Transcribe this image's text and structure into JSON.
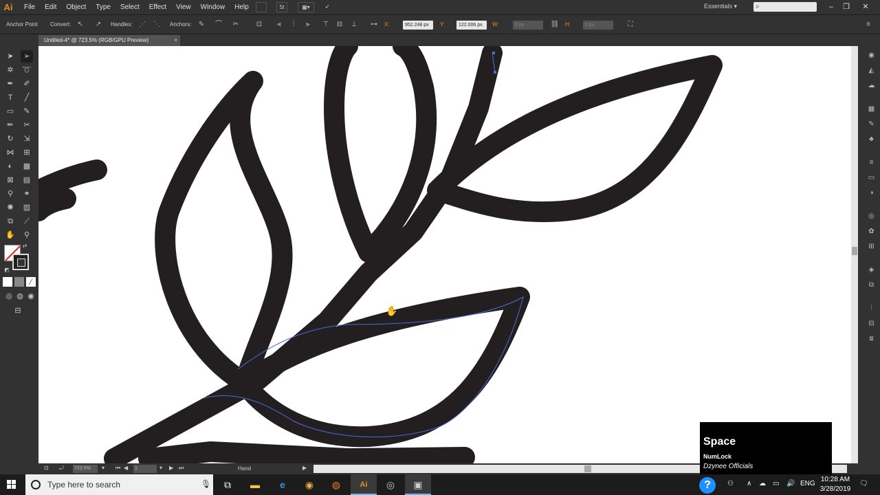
{
  "app": {
    "logo": "Ai",
    "menu": [
      "File",
      "Edit",
      "Object",
      "Type",
      "Select",
      "Effect",
      "View",
      "Window",
      "Help"
    ],
    "menu_icons": [
      "bridge-icon",
      "stock-icon",
      "arrange-documents-icon",
      "gpu-performance-icon"
    ],
    "stock_label": "St",
    "workspace": "Essentials",
    "search_placeholder": "",
    "window_controls": [
      "minimize-icon",
      "restore-icon",
      "close-icon"
    ]
  },
  "control_bar": {
    "anchor_point": "Anchor Point",
    "convert": "Convert:",
    "handles": "Handles:",
    "anchors": "Anchors:",
    "x_label": "X:",
    "x_value": "952.248 px",
    "y_label": "Y:",
    "y_value": "122.006 px",
    "w_label": "W:",
    "w_value": "0 px",
    "h_label": "H:",
    "h_value": "0 px"
  },
  "document": {
    "tab_title": "Untitled-4* @ 723.5% (RGB/GPU Preview)",
    "close_glyph": "×"
  },
  "status_bar": {
    "zoom": "723.5%",
    "page": "1",
    "tool": "Hand"
  },
  "key_overlay": {
    "key": "Space",
    "modifier": "NumLock",
    "brand": "Dzynee Officials"
  },
  "taskbar": {
    "search_placeholder": "Type here to search",
    "apps": [
      "task-view-icon",
      "file-explorer-icon",
      "edge-icon",
      "chrome-icon",
      "firefox-icon",
      "illustrator-icon",
      "obs-icon",
      "store-icon"
    ],
    "help_glyph": "?",
    "language": "ENG",
    "time": "10:28 AM",
    "date": "3/28/2019"
  },
  "colors": {
    "ui_dark": "#323232",
    "artwork_stroke": "#231f20",
    "path_highlight": "#4a6cd4",
    "ai_orange": "#e88d25"
  }
}
